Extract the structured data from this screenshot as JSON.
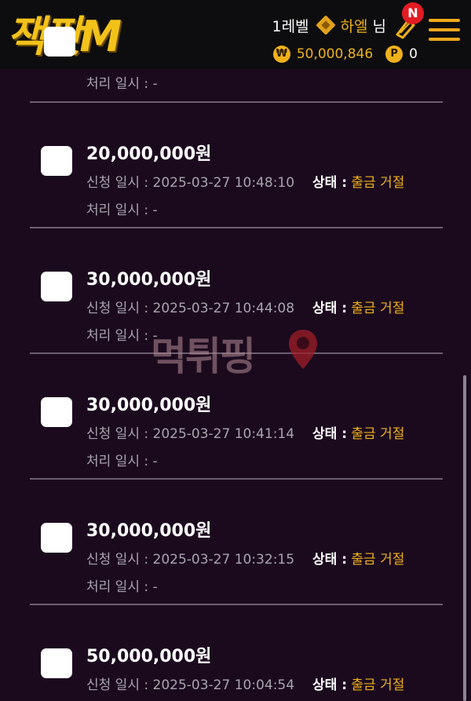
{
  "header": {
    "logo_text": "잭팟M",
    "user_level": "1레벨",
    "user_name": "하엘",
    "user_suffix": "님",
    "notification_badge": "N",
    "money_symbol": "₩",
    "money": "50,000,846",
    "point_symbol": "P",
    "points": "0",
    "accent_color": "#f0b11b"
  },
  "partial_row": {
    "processed_label": "처리 일시 : -"
  },
  "rows": [
    {
      "amount": "20,000,000원",
      "requested": "신청 일시 : 2025-03-27 10:48:10",
      "status_label": "상태 :",
      "status_value": "출금 거절",
      "processed": "처리 일시 : -"
    },
    {
      "amount": "30,000,000원",
      "requested": "신청 일시 : 2025-03-27 10:44:08",
      "status_label": "상태 :",
      "status_value": "출금 거절",
      "processed": "처리 일시 : -"
    },
    {
      "amount": "30,000,000원",
      "requested": "신청 일시 : 2025-03-27 10:41:14",
      "status_label": "상태 :",
      "status_value": "출금 거절",
      "processed": "처리 일시 : -"
    },
    {
      "amount": "30,000,000원",
      "requested": "신청 일시 : 2025-03-27 10:32:15",
      "status_label": "상태 :",
      "status_value": "출금 거절",
      "processed": "처리 일시 : -"
    },
    {
      "amount": "50,000,000원",
      "requested": "신청 일시 : 2025-03-27 10:04:54",
      "status_label": "상태 :",
      "status_value": "출금 거절",
      "processed": ""
    }
  ],
  "watermark": "먹튀핑"
}
